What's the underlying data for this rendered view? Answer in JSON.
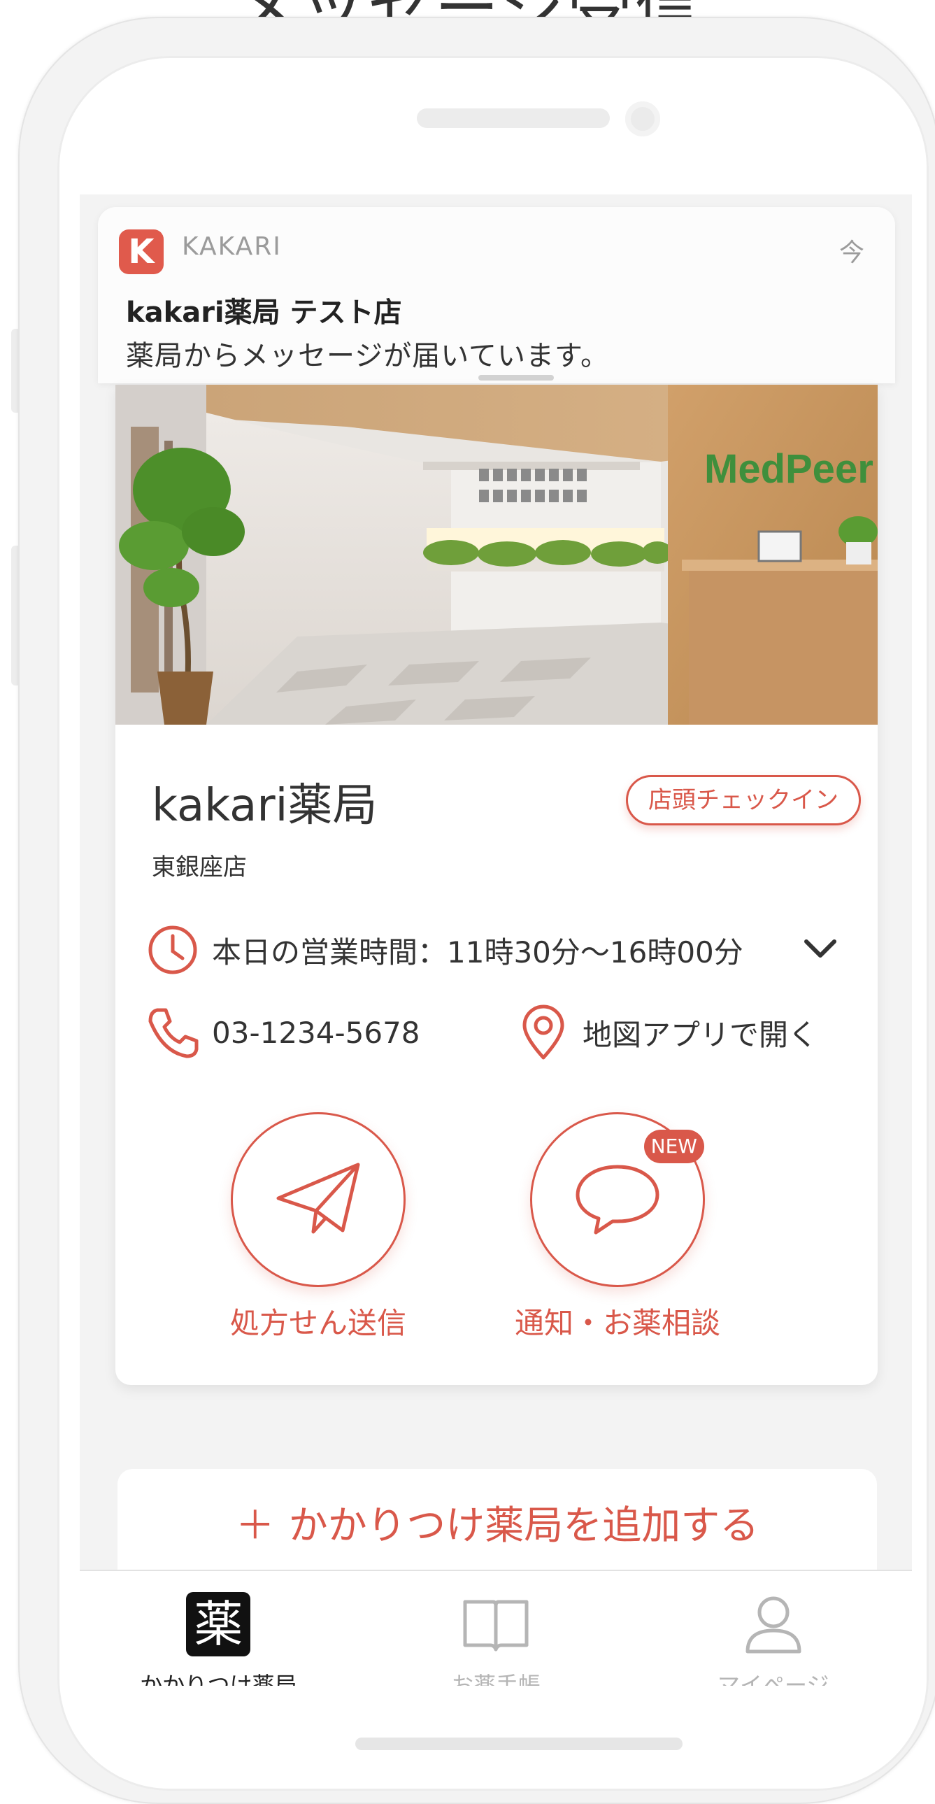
{
  "heading": "メッセージ受信",
  "notification": {
    "app_name": "KAKARI",
    "time": "今",
    "title": "kakari薬局 テスト店",
    "body": "薬局からメッセージが届いています。"
  },
  "pharmacy": {
    "name": "kakari薬局",
    "branch": "東銀座店",
    "checkin_label": "店頭チェックイン",
    "hours": "本日の営業時間：11時30分～16時00分",
    "phone": "03-1234-5678",
    "map_label": "地図アプリで開く",
    "photo_sign": "MedPeer"
  },
  "actions": {
    "send_label": "処方せん送信",
    "consult_label": "通知・お薬相談",
    "new_badge": "NEW"
  },
  "add_pharmacy": {
    "plus": "＋",
    "label": "かかりつけ薬局を追加する"
  },
  "bottom_nav": {
    "items": [
      {
        "icon_char": "薬",
        "label": "かかりつけ薬局",
        "icon": "pharmacy-kanji-icon",
        "active": true
      },
      {
        "label": "お薬手帳",
        "icon": "book-icon",
        "active": false
      },
      {
        "label": "マイページ",
        "icon": "person-icon",
        "active": false
      }
    ]
  },
  "colors": {
    "accent": "#d9584a",
    "text": "#333333",
    "inactive": "#b5b5b5",
    "background": "#f3f3f3"
  }
}
